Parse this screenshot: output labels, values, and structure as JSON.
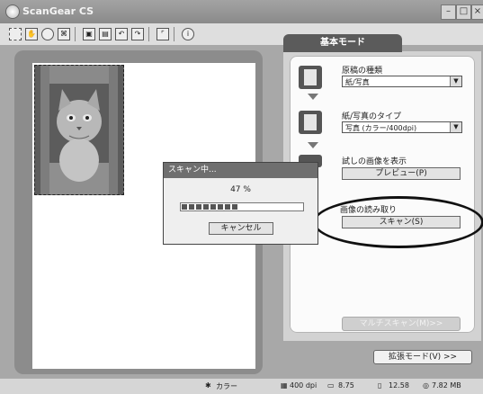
{
  "window": {
    "title": "ScanGear CS"
  },
  "panel": {
    "tab_label": "基本モード",
    "source_type": {
      "label": "原稿の種類",
      "selected": "紙/写真"
    },
    "photo_type": {
      "label": "紙/写真のタイプ",
      "selected": "写真 (カラー/400dpi)"
    },
    "preview": {
      "label": "試しの画像を表示",
      "button": "プレビュー(P)"
    },
    "scan": {
      "label": "画像の読み取り",
      "button": "スキャン(S)"
    },
    "multi_scan_button": "マルチスキャン(M)>>",
    "advanced_mode_button": "拡張モード(V) >>"
  },
  "dialog": {
    "title": "スキャン中...",
    "percent_text": "47 %",
    "progress": 0.47,
    "cancel_button": "キャンセル"
  },
  "statusbar": {
    "color_mode": "カラー",
    "resolution": "400 dpi",
    "width": "8.75",
    "height": "12.58",
    "size": "7.82 MB"
  }
}
